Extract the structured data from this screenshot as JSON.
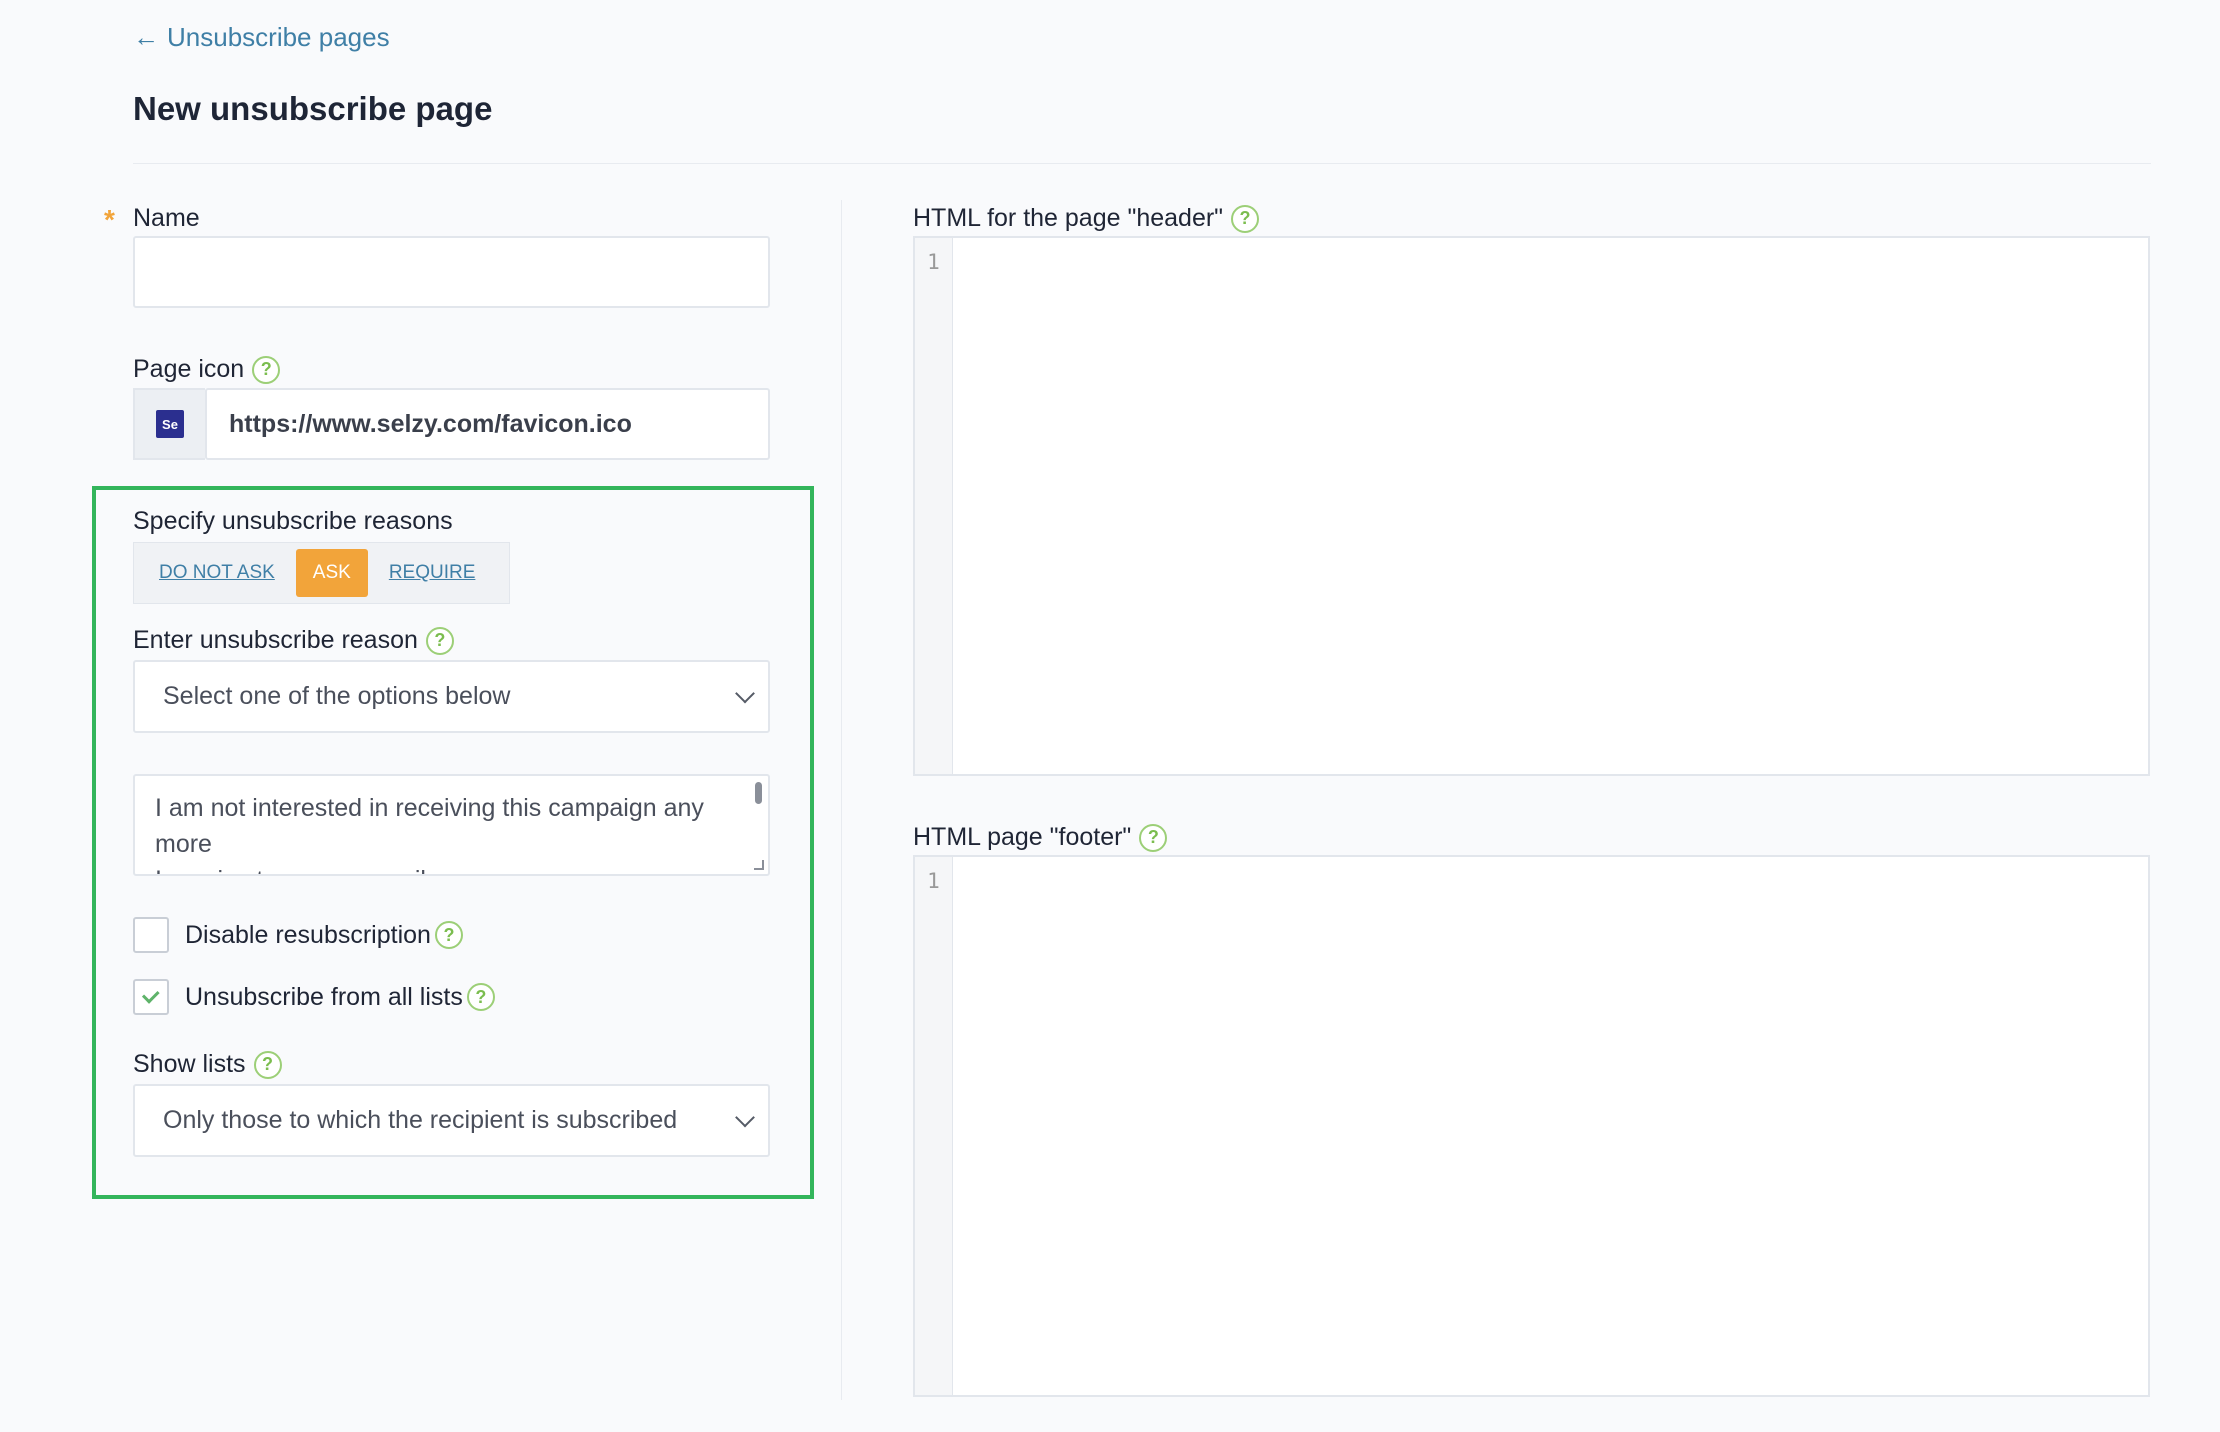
{
  "nav": {
    "back_arrow": "←",
    "back_label": "Unsubscribe pages"
  },
  "page": {
    "title": "New unsubscribe page"
  },
  "form": {
    "name_label": "Name",
    "required_mark": "*",
    "name_value": "",
    "page_icon_label": "Page icon",
    "page_icon_url": "https://www.selzy.com/favicon.ico",
    "favicon_text": "Se",
    "reasons_label": "Specify unsubscribe reasons",
    "reason_modes": [
      "DO NOT ASK",
      "ASK",
      "REQUIRE"
    ],
    "reason_mode_selected": "ASK",
    "enter_reason_label": "Enter unsubscribe reason",
    "reason_select_value": "Select one of the options below",
    "reasons_text_line1": "I am not interested in receiving this campaign any more",
    "reasons_text_line2": "I receive too many emails",
    "disable_resub_label": "Disable resubscription",
    "disable_resub_checked": false,
    "unsub_all_label": "Unsubscribe from all lists",
    "unsub_all_checked": true,
    "show_lists_label": "Show lists",
    "show_lists_value": "Only those to which the recipient is subscribed"
  },
  "editors": {
    "header_label": "HTML for the page \"header\"",
    "footer_label": "HTML page \"footer\"",
    "line_number": "1"
  },
  "help_glyph": "?",
  "colors": {
    "accent_orange": "#f2a43a",
    "link_blue": "#3f7fa6",
    "help_green": "#7bbd4f",
    "highlight_green": "#33b55b",
    "check_green": "#5fb36a"
  },
  "icons": {
    "back": "arrow-left-icon",
    "help": "question-circle-icon",
    "dropdown": "chevron-down-icon",
    "check": "checkmark-icon"
  }
}
